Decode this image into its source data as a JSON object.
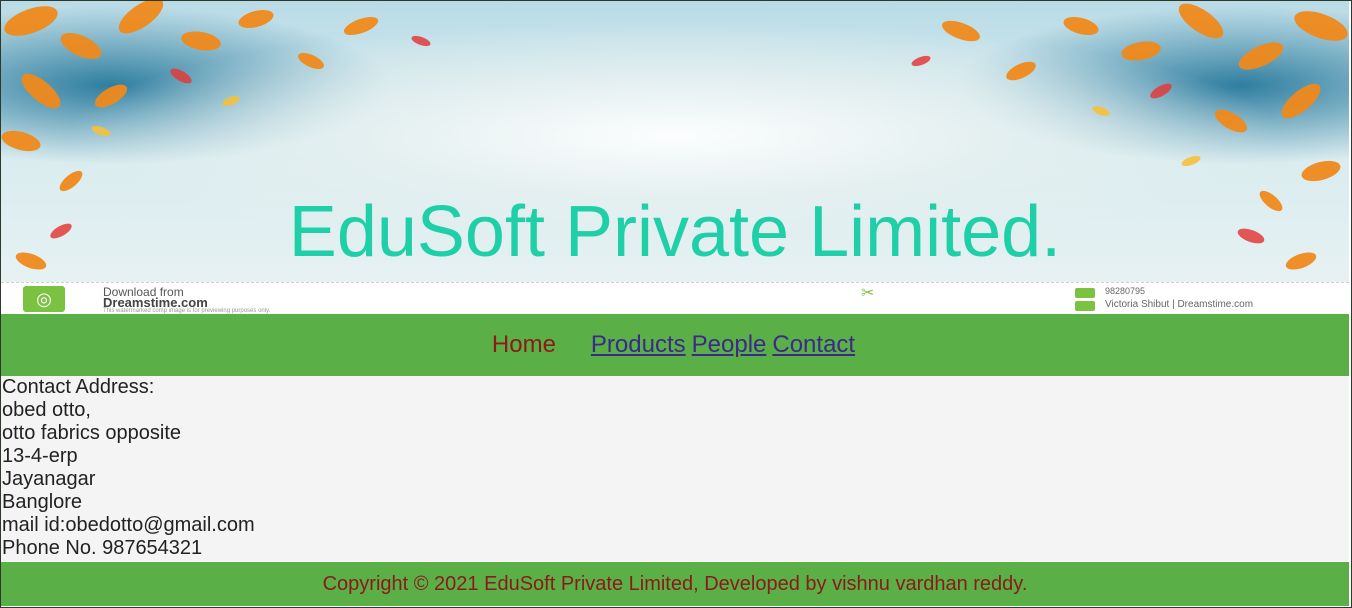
{
  "banner": {
    "title": "EduSoft Private Limited.",
    "watermark": {
      "from": "Download from",
      "site": "Dreamstime.com",
      "note": "This watermarked comp image is for previewing purposes only.",
      "image_id": "98280795",
      "author": "Victoria Shibut | Dreamstime.com"
    }
  },
  "nav": {
    "home": "Home",
    "products": "Products",
    "people": "People",
    "contact": "Contact"
  },
  "contact": {
    "lines": [
      "Contact Address:",
      "obed otto,",
      "otto fabrics opposite",
      "13-4-erp",
      "Jayanagar",
      "Banglore",
      "mail id:obedotto@gmail.com",
      "Phone No. 987654321"
    ]
  },
  "footer": {
    "text": "Copyright © 2021 EduSoft Private Limited, Developed by vishnu vardhan reddy."
  },
  "colors": {
    "nav_bg": "#5aaf46",
    "title": "#1fcfa7",
    "home": "#8b1a1a",
    "link": "#3b2a8a",
    "content_bg": "#f4f4f4"
  }
}
